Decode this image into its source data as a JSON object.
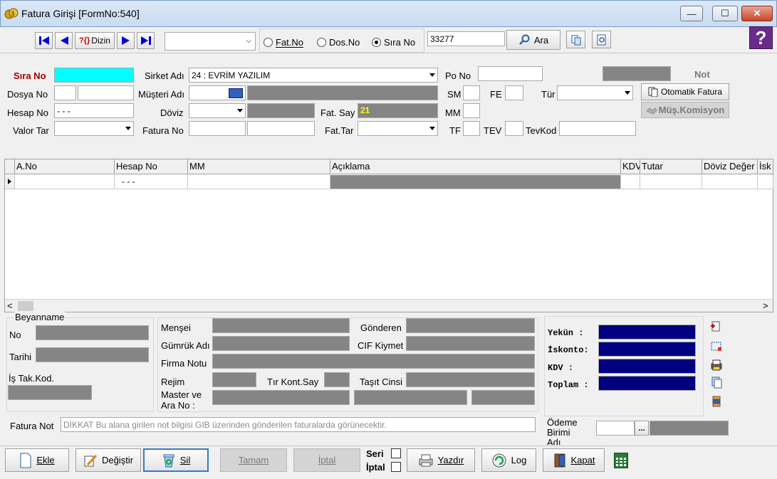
{
  "window": {
    "title": "Fatura Girişi [FormNo:540]",
    "minimize": "—",
    "maximize": "☐",
    "close": "✕"
  },
  "toolbar": {
    "dizin_label": "Dizin",
    "search_mode_value": "",
    "radio_fatno": "Fat.No",
    "radio_dosno": "Dos.No",
    "radio_sirano": "Sıra No",
    "selected_radio": "Sıra No",
    "search_value": "33277",
    "ara_label": "Ara",
    "help_icon": "?"
  },
  "header": {
    "sira_no_label": "Sıra No",
    "sira_no_value": "",
    "sirket_adi_label": "Sirket Adı",
    "sirket_adi_value": "24 : EVRİM YAZILIM",
    "po_no_label": "Po No",
    "po_no_value": "",
    "not_label": "Not",
    "dosya_no_label": "Dosya No",
    "musteri_adi_label": "Müşteri Adı",
    "sm_label": "SM",
    "fe_label": "FE",
    "tur_label": "Tür",
    "otomatik_fatura_label": "Otomatik Fatura",
    "hesap_no_label": "Hesap No",
    "hesap_no_value": "- - -",
    "doviz_label": "Döviz",
    "fat_say_label": "Fat. Say",
    "fat_say_value": "21",
    "mm_label": "MM",
    "mus_komisyon_label": "Müş.Komisyon",
    "valor_tar_label": "Valor Tar",
    "fatura_no_label": "Fatura No",
    "fat_tar_label": "Fat.Tar",
    "tf_label": "TF",
    "tev_label": "TEV",
    "tevkod_label": "TevKod"
  },
  "grid": {
    "columns": [
      "A.No",
      "Hesap No",
      "MM",
      "Açıklama",
      "KDV",
      "Tutar",
      "Döviz Değer",
      "İsk"
    ],
    "rows": [
      {
        "a_no": "",
        "hesap_no": "- - -",
        "mm": "",
        "aciklama": "",
        "kdv": "",
        "tutar": "",
        "doviz_deger": "",
        "isk": ""
      }
    ],
    "scroll_left": "<",
    "scroll_right": ">"
  },
  "beyanname": {
    "title": "Beyanname",
    "no_label": "No",
    "tarihi_label": "Tarihi",
    "is_tak_kod_label": "İş Tak.Kod."
  },
  "middle": {
    "mensei_label": "Menşei",
    "gonderen_label": "Gönderen",
    "gumruk_adi_label": "Gümrük Adı",
    "cif_kiymet_label": "CIF Kiymet",
    "firma_notu_label": "Firma Notu",
    "rejim_label": "Rejim",
    "tir_kont_say_label": "Tır Kont.Say",
    "tasit_cinsi_label": "Taşıt Cinsi",
    "master_ara_no_label_1": "Master ve",
    "master_ara_no_label_2": "Ara No :"
  },
  "totals": {
    "yekun_label": "Yekün  :",
    "iskonto_label": "İskonto:",
    "kdv_label": "KDV    :",
    "toplam_label": "Toplam :"
  },
  "fatura_not": {
    "label": "Fatura Not",
    "placeholder": "DİKKAT Bu alana girilen not bilgisi GIB üzerinden gönderilen faturalarda görünecektir."
  },
  "odeme": {
    "label_1": "Ödeme",
    "label_2": "Birimi",
    "label_3": "Adı",
    "button": "..."
  },
  "bottom": {
    "ekle": "Ekle",
    "degistir": "Değiştir",
    "sil": "Sil",
    "tamam": "Tamam",
    "iptal": "İptal",
    "seri": "Seri",
    "iptal_check": "İptal",
    "yazdir": "Yazdır",
    "log": "Log",
    "kapat": "Kapat"
  },
  "colors": {
    "accent_navy": "#000080",
    "cyan": "#00ffff",
    "field_gray": "#858585",
    "label_red": "#a00000",
    "fat_say_yellow": "#ffff00"
  }
}
